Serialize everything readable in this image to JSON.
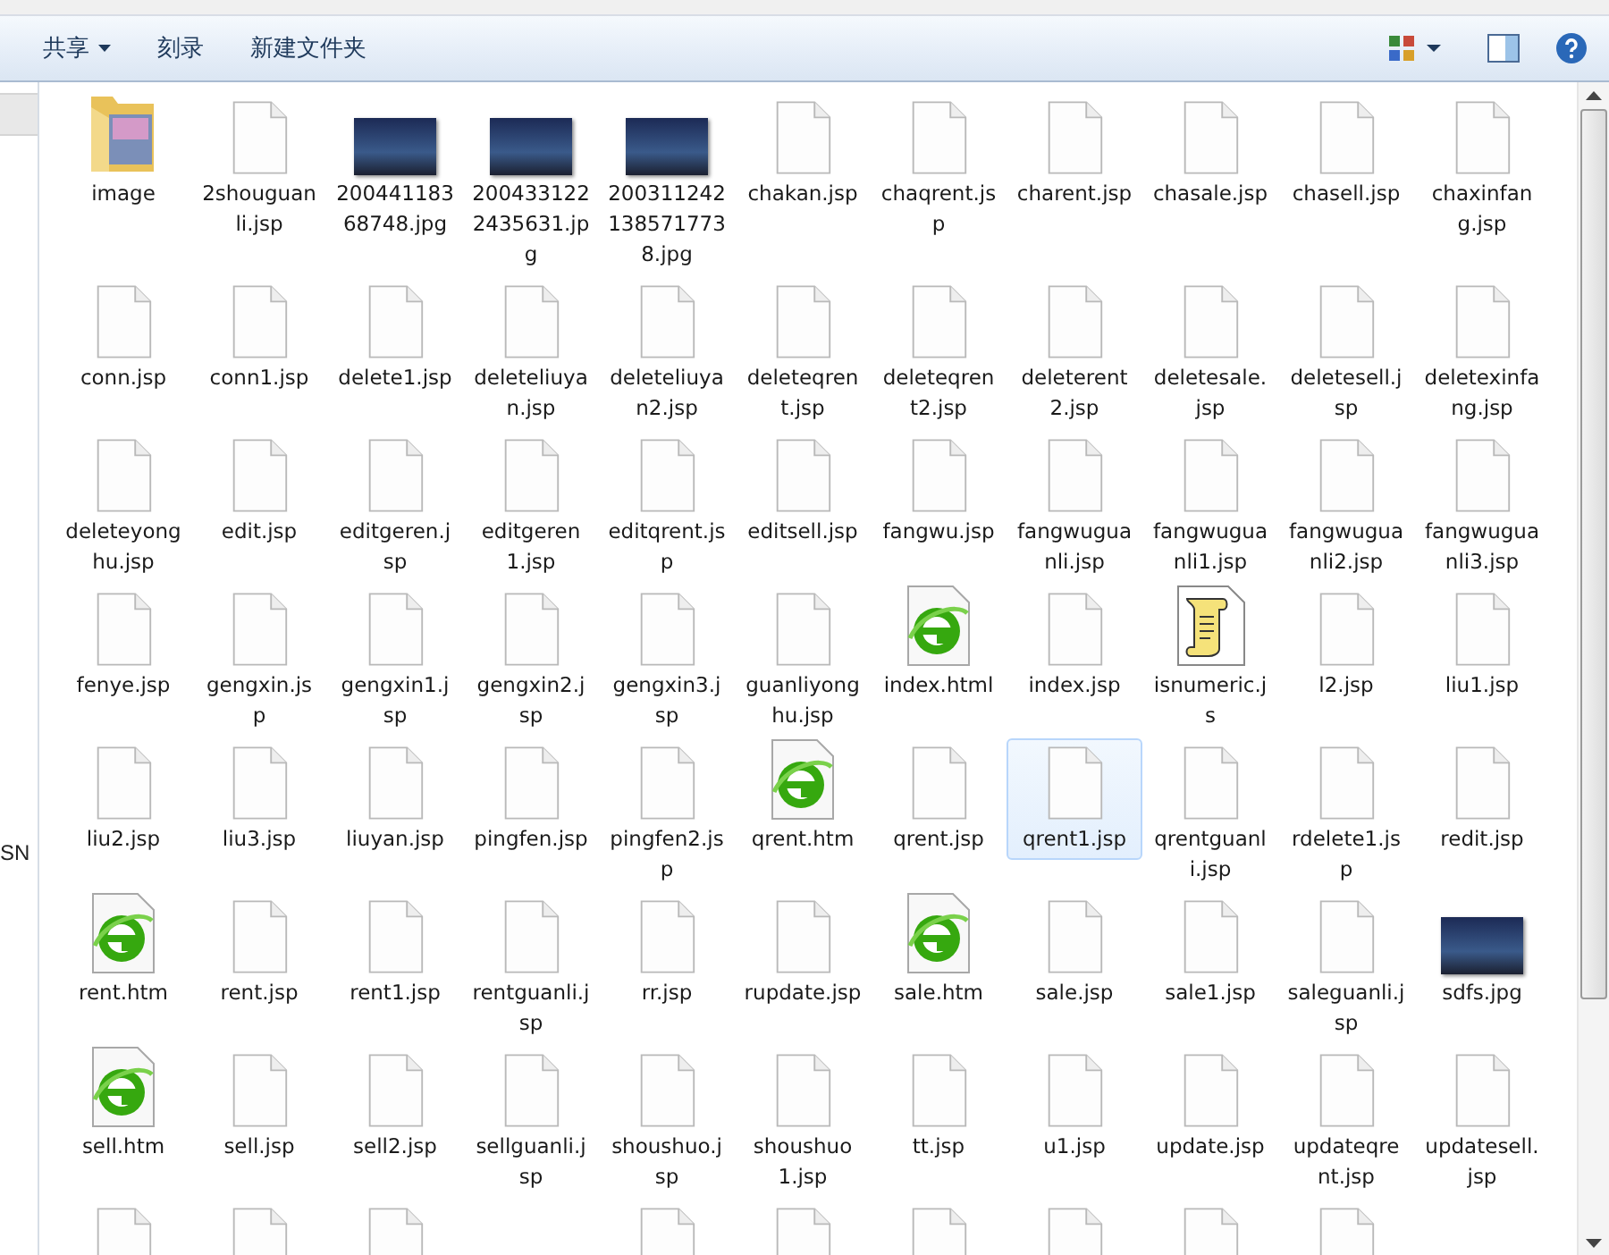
{
  "toolbar": {
    "buttons": [
      {
        "label": "共享",
        "dropdown": true
      },
      {
        "label": "刻录",
        "dropdown": false
      },
      {
        "label": "新建文件夹",
        "dropdown": false
      }
    ]
  },
  "navigation_pane": {
    "label": "SN"
  },
  "files": [
    {
      "name": "image",
      "kind": "folder",
      "selected": false
    },
    {
      "name": "2shouguanli.jsp",
      "kind": "file",
      "selected": false
    },
    {
      "name": "20044118368748.jpg",
      "kind": "photo",
      "selected": false
    },
    {
      "name": "2004331222435631.jpg",
      "kind": "photo",
      "selected": false
    },
    {
      "name": "2003112421385717738.jpg",
      "kind": "photo",
      "selected": false
    },
    {
      "name": "chakan.jsp",
      "kind": "file",
      "selected": false
    },
    {
      "name": "chaqrent.jsp",
      "kind": "file",
      "selected": false
    },
    {
      "name": "charent.jsp",
      "kind": "file",
      "selected": false
    },
    {
      "name": "chasale.jsp",
      "kind": "file",
      "selected": false
    },
    {
      "name": "chasell.jsp",
      "kind": "file",
      "selected": false
    },
    {
      "name": "chaxinfang.jsp",
      "kind": "file",
      "selected": false
    },
    {
      "name": "conn.jsp",
      "kind": "file",
      "selected": false
    },
    {
      "name": "conn1.jsp",
      "kind": "file",
      "selected": false
    },
    {
      "name": "delete1.jsp",
      "kind": "file",
      "selected": false
    },
    {
      "name": "deleteliuyan.jsp",
      "kind": "file",
      "selected": false
    },
    {
      "name": "deleteliuyan2.jsp",
      "kind": "file",
      "selected": false
    },
    {
      "name": "deleteqrent.jsp",
      "kind": "file",
      "selected": false
    },
    {
      "name": "deleteqrent2.jsp",
      "kind": "file",
      "selected": false
    },
    {
      "name": "deleterent2.jsp",
      "kind": "file",
      "selected": false
    },
    {
      "name": "deletesale.jsp",
      "kind": "file",
      "selected": false
    },
    {
      "name": "deletesell.jsp",
      "kind": "file",
      "selected": false
    },
    {
      "name": "deletexinfang.jsp",
      "kind": "file",
      "selected": false
    },
    {
      "name": "deleteyonghu.jsp",
      "kind": "file",
      "selected": false
    },
    {
      "name": "edit.jsp",
      "kind": "file",
      "selected": false
    },
    {
      "name": "editgeren.jsp",
      "kind": "file",
      "selected": false
    },
    {
      "name": "editgeren1.jsp",
      "kind": "file",
      "selected": false
    },
    {
      "name": "editqrent.jsp",
      "kind": "file",
      "selected": false
    },
    {
      "name": "editsell.jsp",
      "kind": "file",
      "selected": false
    },
    {
      "name": "fangwu.jsp",
      "kind": "file",
      "selected": false
    },
    {
      "name": "fangwuguanli.jsp",
      "kind": "file",
      "selected": false
    },
    {
      "name": "fangwuguanli1.jsp",
      "kind": "file",
      "selected": false
    },
    {
      "name": "fangwuguanli2.jsp",
      "kind": "file",
      "selected": false
    },
    {
      "name": "fangwuguanli3.jsp",
      "kind": "file",
      "selected": false
    },
    {
      "name": "fenye.jsp",
      "kind": "file",
      "selected": false
    },
    {
      "name": "gengxin.jsp",
      "kind": "file",
      "selected": false
    },
    {
      "name": "gengxin1.jsp",
      "kind": "file",
      "selected": false
    },
    {
      "name": "gengxin2.jsp",
      "kind": "file",
      "selected": false
    },
    {
      "name": "gengxin3.jsp",
      "kind": "file",
      "selected": false
    },
    {
      "name": "guanliyonghu.jsp",
      "kind": "file",
      "selected": false
    },
    {
      "name": "index.html",
      "kind": "web",
      "selected": false
    },
    {
      "name": "index.jsp",
      "kind": "file",
      "selected": false
    },
    {
      "name": "isnumeric.js",
      "kind": "script",
      "selected": false
    },
    {
      "name": "l2.jsp",
      "kind": "file",
      "selected": false
    },
    {
      "name": "liu1.jsp",
      "kind": "file",
      "selected": false
    },
    {
      "name": "liu2.jsp",
      "kind": "file",
      "selected": false
    },
    {
      "name": "liu3.jsp",
      "kind": "file",
      "selected": false
    },
    {
      "name": "liuyan.jsp",
      "kind": "file",
      "selected": false
    },
    {
      "name": "pingfen.jsp",
      "kind": "file",
      "selected": false
    },
    {
      "name": "pingfen2.jsp",
      "kind": "file",
      "selected": false
    },
    {
      "name": "qrent.htm",
      "kind": "web",
      "selected": false
    },
    {
      "name": "qrent.jsp",
      "kind": "file",
      "selected": false
    },
    {
      "name": "qrent1.jsp",
      "kind": "file",
      "selected": true
    },
    {
      "name": "qrentguanli.jsp",
      "kind": "file",
      "selected": false
    },
    {
      "name": "rdelete1.jsp",
      "kind": "file",
      "selected": false
    },
    {
      "name": "redit.jsp",
      "kind": "file",
      "selected": false
    },
    {
      "name": "rent.htm",
      "kind": "web",
      "selected": false
    },
    {
      "name": "rent.jsp",
      "kind": "file",
      "selected": false
    },
    {
      "name": "rent1.jsp",
      "kind": "file",
      "selected": false
    },
    {
      "name": "rentguanli.jsp",
      "kind": "file",
      "selected": false
    },
    {
      "name": "rr.jsp",
      "kind": "file",
      "selected": false
    },
    {
      "name": "rupdate.jsp",
      "kind": "file",
      "selected": false
    },
    {
      "name": "sale.htm",
      "kind": "web",
      "selected": false
    },
    {
      "name": "sale.jsp",
      "kind": "file",
      "selected": false
    },
    {
      "name": "sale1.jsp",
      "kind": "file",
      "selected": false
    },
    {
      "name": "saleguanli.jsp",
      "kind": "file",
      "selected": false
    },
    {
      "name": "sdfs.jpg",
      "kind": "photo",
      "selected": false
    },
    {
      "name": "sell.htm",
      "kind": "web",
      "selected": false
    },
    {
      "name": "sell.jsp",
      "kind": "file",
      "selected": false
    },
    {
      "name": "sell2.jsp",
      "kind": "file",
      "selected": false
    },
    {
      "name": "sellguanli.jsp",
      "kind": "file",
      "selected": false
    },
    {
      "name": "shoushuo.jsp",
      "kind": "file",
      "selected": false
    },
    {
      "name": "shoushuo1.jsp",
      "kind": "file",
      "selected": false
    },
    {
      "name": "tt.jsp",
      "kind": "file",
      "selected": false
    },
    {
      "name": "u1.jsp",
      "kind": "file",
      "selected": false
    },
    {
      "name": "update.jsp",
      "kind": "file",
      "selected": false
    },
    {
      "name": "updateqrent.jsp",
      "kind": "file",
      "selected": false
    },
    {
      "name": "updatesell.jsp",
      "kind": "file",
      "selected": false
    }
  ],
  "partly_visible_row": [
    {
      "kind": "file"
    },
    {
      "kind": "file"
    },
    {
      "kind": "file"
    },
    {
      "kind": "none"
    },
    {
      "kind": "file"
    },
    {
      "kind": "file"
    },
    {
      "kind": "file"
    },
    {
      "kind": "file"
    },
    {
      "kind": "file"
    },
    {
      "kind": "file"
    },
    {
      "kind": "none"
    }
  ]
}
